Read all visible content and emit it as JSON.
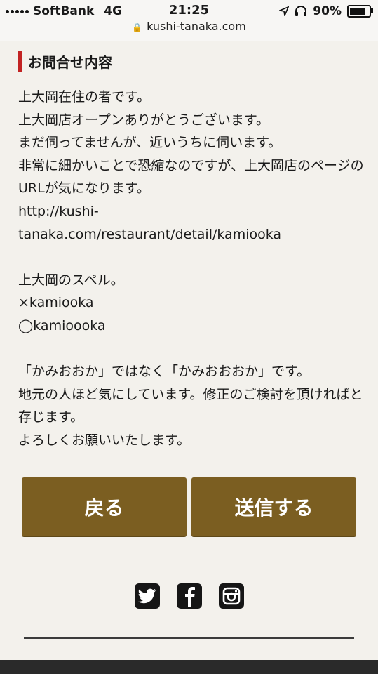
{
  "status_bar": {
    "carrier": "SoftBank",
    "network": "4G",
    "time": "21:25",
    "battery": "90%",
    "url": "kushi-tanaka.com"
  },
  "section": {
    "title": "お問合せ内容"
  },
  "message": "上大岡在住の者です。\n上大岡店オープンありがとうございます。\nまだ伺ってませんが、近いうちに伺います。\n非常に細かいことで恐縮なのですが、上大岡店のページのURLが気になります。\nhttp://kushi-\ntanaka.com/restaurant/detail/kamiooka\n\n上大岡のスペル。\n×kamiooka\n◯kamioooka\n\n「かみおおか」ではなく「かみおおおか」です。\n地元の人ほど気にしています。修正のご検討を頂ければと存じます。\nよろしくお願いいたします。",
  "buttons": {
    "back": "戻る",
    "send": "送信する"
  },
  "social": [
    "twitter-icon",
    "facebook-icon",
    "instagram-icon"
  ],
  "colors": {
    "button_brown": "#7b5e21",
    "accent_red": "#c22323"
  }
}
